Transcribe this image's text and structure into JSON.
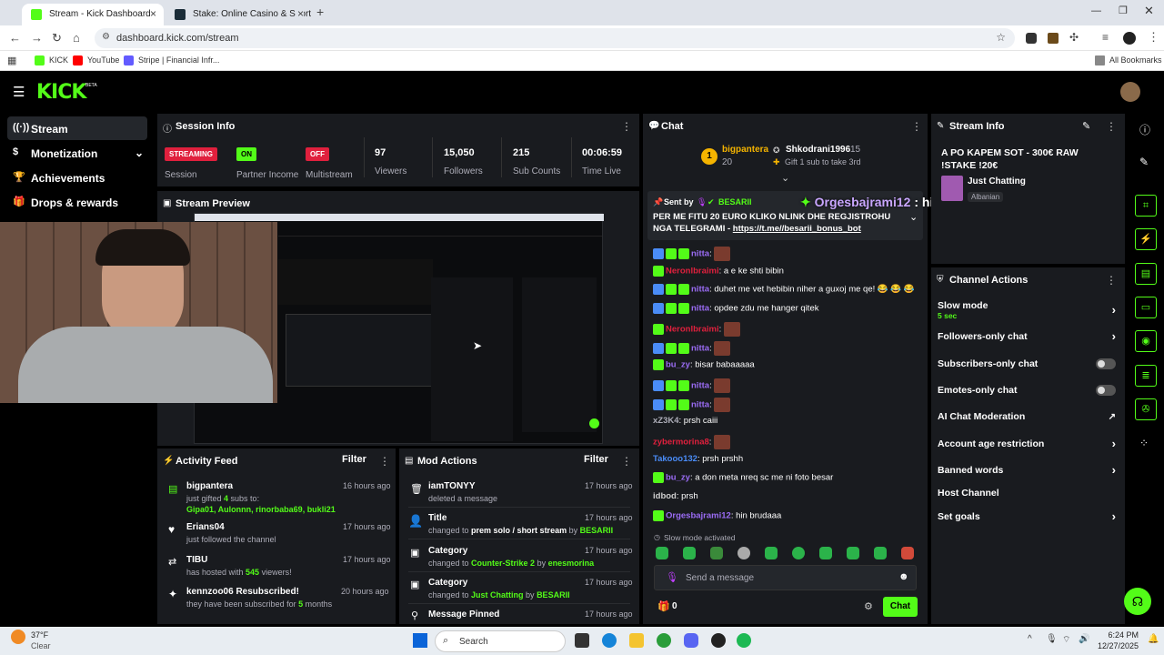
{
  "browser": {
    "tabs": [
      {
        "label": "Stream - Kick Dashboard"
      },
      {
        "label": "Stake: Online Casino & Sports B"
      }
    ],
    "url": "dashboard.kick.com/stream",
    "bookmarks": [
      "KICK",
      "YouTube",
      "Stripe | Financial Infr..."
    ],
    "all_bookmarks": "All Bookmarks"
  },
  "sidebar": {
    "items": [
      {
        "label": "Stream"
      },
      {
        "label": "Monetization"
      },
      {
        "label": "Achievements"
      },
      {
        "label": "Drops & rewards"
      }
    ]
  },
  "session": {
    "title": "Session Info",
    "streaming_badge": "STREAMING",
    "streaming_label": "Session",
    "partner_badge": "ON",
    "partner_label": "Partner Income",
    "multistream_badge": "OFF",
    "multistream_label": "Multistream",
    "viewers": "97",
    "viewers_label": "Viewers",
    "followers": "15,050",
    "followers_label": "Followers",
    "subs": "215",
    "subs_label": "Sub Counts",
    "time": "00:06:59",
    "time_label": "Time Live"
  },
  "preview": {
    "title": "Stream Preview"
  },
  "activity": {
    "title": "Activity Feed",
    "filter": "Filter",
    "items": [
      {
        "name": "bigpantera",
        "time": "16 hours ago",
        "pre": "just gifted ",
        "count": "4",
        "post": " subs to:",
        "extra": "Gipa01, Aulonnn, rinorbaba69, bukli21"
      },
      {
        "name": "Erians04",
        "time": "17 hours ago",
        "desc": "just followed the channel"
      },
      {
        "name": "TIBU",
        "time": "17 hours ago",
        "pre": "has hosted with ",
        "count": "545",
        "post": " viewers!"
      },
      {
        "name": "kennzoo06 Resubscribed!",
        "time": "20 hours ago",
        "pre": "they have been subscribed for ",
        "count": "5",
        "post": " months"
      }
    ]
  },
  "mod": {
    "title": "Mod Actions",
    "filter": "Filter",
    "items": [
      {
        "name": "iamTONYY",
        "time": "17 hours ago",
        "desc": "deleted a message"
      },
      {
        "name": "Title",
        "time": "17 hours ago",
        "pre": "changed to ",
        "val": "prem solo / short stream",
        "by": " by ",
        "user": "BESARII"
      },
      {
        "name": "Category",
        "time": "17 hours ago",
        "pre": "changed to ",
        "val": "Counter-Strike 2",
        "by": " by ",
        "user": "enesmorina"
      },
      {
        "name": "Category",
        "time": "17 hours ago",
        "pre": "changed to ",
        "val": "Just Chatting",
        "by": " by ",
        "user": "BESARII"
      },
      {
        "name": "Message Pinned",
        "time": "17 hours ago"
      }
    ]
  },
  "chat": {
    "title": "Chat",
    "top_gifter": "bigpantera",
    "top_gifter_count": "20",
    "second": "Shkodrani1996",
    "second_count": "15",
    "gift_hint": "Gift 1 sub to take 3rd",
    "pinned_sent_by": "Sent by",
    "pinned_user": "BESARII",
    "pinned_text": "PER ME FITU 20 EURO KLIKO NLINK DHE REGJISTROHU NGA TELEGRAMI - ",
    "pinned_link": "https://t.me//besarii_bonus_bot",
    "overlay_user": "Orgesbajrami12",
    "overlay_msg": " : hin brudaaa",
    "messages": [
      {
        "user": "nitta",
        "color": "#9b6cf5",
        "text": "",
        "emote": true,
        "badges": 3
      },
      {
        "user": "Neronlbraimi",
        "color": "#e0203d",
        "text": ": a e ke shti bibin",
        "badges": 1
      },
      {
        "user": "nitta",
        "color": "#9b6cf5",
        "text": ": duhet me vet hebibin niher a guxoj me qe! 😂 😂 😂",
        "badges": 3
      },
      {
        "user": "nitta",
        "color": "#9b6cf5",
        "text": ": opdee zdu me hanger qitek",
        "badges": 3
      },
      {
        "user": "Neronlbraimi",
        "color": "#e0203d",
        "text": "",
        "emote": true,
        "badges": 1
      },
      {
        "user": "nitta",
        "color": "#9b6cf5",
        "text": "",
        "emote": true,
        "badges": 3
      },
      {
        "user": "bu_zy",
        "color": "#9b6cf5",
        "text": ": bisar babaaaaa",
        "badges": 1
      },
      {
        "user": "nitta",
        "color": "#9b6cf5",
        "text": "",
        "emote": true,
        "badges": 3
      },
      {
        "user": "nitta",
        "color": "#9b6cf5",
        "text": "",
        "emote": true,
        "badges": 3
      },
      {
        "user": "xZ3K4",
        "color": "#adadb8",
        "text": ": prsh caiii",
        "badges": 0
      },
      {
        "user": "zybermorina8",
        "color": "#e0203d",
        "text": "",
        "emote": true,
        "badges": 0
      },
      {
        "user": "Takooo132",
        "color": "#4a8cf7",
        "text": ": prsh prshh",
        "badges": 0
      },
      {
        "user": "bu_zy",
        "color": "#9b6cf5",
        "text": ": a don meta nreq sc me ni foto besar",
        "badges": 1
      },
      {
        "user": "idbod",
        "color": "#cfcfcf",
        "text": ": prsh",
        "badges": 0
      },
      {
        "user": "Orgesbajrami12",
        "color": "#9b6cf5",
        "text": ": hin brudaaa",
        "badges": 1
      }
    ],
    "slow_mode_note": "Slow mode activated",
    "input_placeholder": "Send a message",
    "points": "0",
    "send": "Chat"
  },
  "stream_info": {
    "title": "Stream Info",
    "stream_title": "A PO KAPEM SOT - 300€ RAW !STAKE !20€",
    "category": "Just Chatting",
    "language": "Albanian"
  },
  "channel_actions": {
    "title": "Channel Actions",
    "slow_mode": "Slow mode",
    "slow_mode_value": "5 sec",
    "followers_only": "Followers-only chat",
    "subscribers_only": "Subscribers-only chat",
    "emotes_only": "Emotes-only chat",
    "ai_mod": "AI Chat Moderation",
    "account_age": "Account age restriction",
    "banned_words": "Banned words",
    "host": "Host Channel",
    "goals": "Set goals"
  },
  "taskbar": {
    "temp": "37°F",
    "weather": "Clear",
    "search": "Search",
    "time": "6:24 PM",
    "date": "12/27/2025"
  },
  "colors": {
    "accent": "#53fc18",
    "panel": "#191b1f",
    "streaming": "#e0203d"
  }
}
